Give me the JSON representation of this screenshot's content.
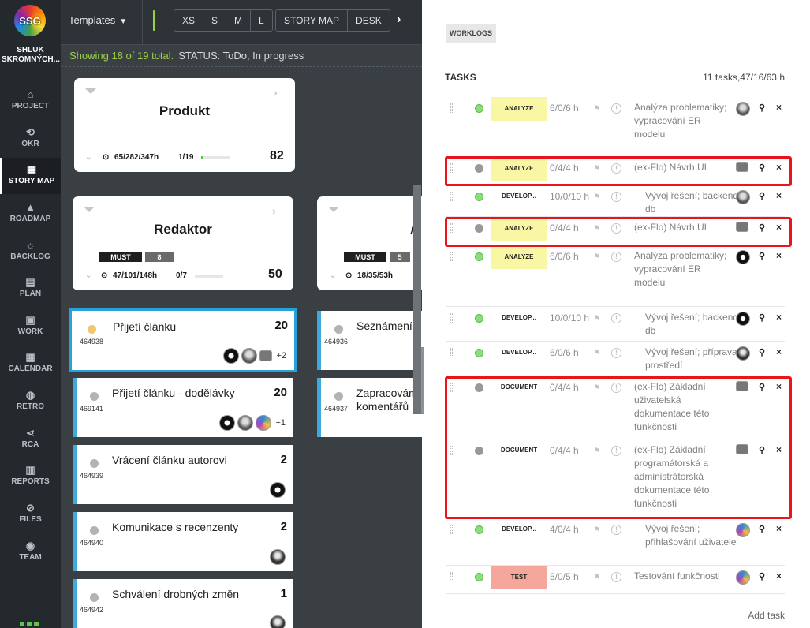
{
  "nav": {
    "logo_text": "SSG",
    "org_name": "SHLUK\nSKROMNÝCH...",
    "items": [
      {
        "label": "PROJECT",
        "icon": "home-icon",
        "glyph": "⌂"
      },
      {
        "label": "OKR",
        "icon": "okr-icon",
        "glyph": "⟲"
      },
      {
        "label": "STORY MAP",
        "icon": "grid-icon",
        "glyph": "▦",
        "active": true
      },
      {
        "label": "ROADMAP",
        "icon": "road-icon",
        "glyph": "▲"
      },
      {
        "label": "BACKLOG",
        "icon": "bulb-icon",
        "glyph": "☼"
      },
      {
        "label": "PLAN",
        "icon": "plan-icon",
        "glyph": "▤"
      },
      {
        "label": "WORK",
        "icon": "briefcase-icon",
        "glyph": "▣"
      },
      {
        "label": "CALENDAR",
        "icon": "calendar-icon",
        "glyph": "▦"
      },
      {
        "label": "RETRO",
        "icon": "chat-icon",
        "glyph": "◍"
      },
      {
        "label": "RCA",
        "icon": "share-icon",
        "glyph": "⋖"
      },
      {
        "label": "REPORTS",
        "icon": "chart-icon",
        "glyph": "▥"
      },
      {
        "label": "FILES",
        "icon": "paperclip-icon",
        "glyph": "⊘"
      },
      {
        "label": "TEAM",
        "icon": "team-icon",
        "glyph": "◉"
      }
    ]
  },
  "topbar": {
    "templates_label": "Templates",
    "sizes": [
      "XS",
      "S",
      "M",
      "L"
    ],
    "views": [
      "STORY MAP",
      "DESK"
    ]
  },
  "filter": {
    "showing": "Showing 18 of 19 total.",
    "status": "STATUS: ToDo, In progress"
  },
  "epics": [
    {
      "title": "Produkt",
      "stats": "65/282/347h",
      "progress": "1/19",
      "progress_fraction": 0.05,
      "count": "82"
    },
    {
      "title": "Redaktor",
      "stats": "47/101/148h",
      "progress": "0/7",
      "progress_fraction": 0,
      "count": "50",
      "tag": "MUST",
      "tag_num": "8"
    },
    {
      "title": "A",
      "stats": "18/35/53h",
      "tag": "MUST",
      "tag_num": "5"
    }
  ],
  "stories": [
    {
      "title": "Přijetí článku",
      "id": "464938",
      "points": "20",
      "more": "+2"
    },
    {
      "title": "Přijetí článku - dodělávky",
      "id": "469141",
      "points": "20",
      "more": "+1"
    },
    {
      "title": "Vrácení článku autorovi",
      "id": "464939",
      "points": "2"
    },
    {
      "title": "Komunikace s recenzenty",
      "id": "464940",
      "points": "2"
    },
    {
      "title": "Schválení drobných změn",
      "id": "464942",
      "points": "1"
    },
    {
      "title": "Seznámení",
      "id": "464936"
    },
    {
      "title": "Zapracován\nkomentářů",
      "id": "464937"
    }
  ],
  "panel": {
    "worklogs_label": "WORKLOGS",
    "tasks_label": "TASKS",
    "tasks_summary": "11  tasks,47/16/63 h",
    "add_task": "Add task",
    "tasks": [
      {
        "type": "ANALYZE",
        "hours": "6/0/6 h",
        "desc": "Analýza problematiky; vypracování ER modelu",
        "status": "green",
        "avatar": "photo"
      },
      {
        "type": "ANALYZE",
        "hours": "0/4/4 h",
        "desc": "(ex-Flo) Návrh UI",
        "status": "gray",
        "avatar": "robot"
      },
      {
        "type": "DEVELOP...",
        "hours": "10/0/10 h",
        "desc": "Vývoj řešení; backend db",
        "status": "green",
        "avatar": "photo"
      },
      {
        "type": "ANALYZE",
        "hours": "0/4/4 h",
        "desc": "(ex-Flo) Návrh UI",
        "status": "gray",
        "avatar": "robot"
      },
      {
        "type": "ANALYZE",
        "hours": "6/0/6 h",
        "desc": "Analýza problematiky; vypracování ER modelu",
        "status": "green",
        "avatar": "spiky"
      },
      {
        "type": "DEVELOP...",
        "hours": "10/0/10 h",
        "desc": "Vývoj řešení; backend db",
        "status": "green",
        "avatar": "spiky"
      },
      {
        "type": "DEVELOP...",
        "hours": "6/0/6 h",
        "desc": "Vývoj řešení; příprava prostředí",
        "status": "green",
        "avatar": "dark"
      },
      {
        "type": "DOCUMENT",
        "hours": "0/4/4 h",
        "desc": "(ex-Flo) Základní uživatelská dokumentace této funkčnosti",
        "status": "gray",
        "avatar": "robot"
      },
      {
        "type": "DOCUMENT",
        "hours": "0/4/4 h",
        "desc": "(ex-Flo) Základní programátorská a administrátorská dokumentace této funkčnosti",
        "status": "gray",
        "avatar": "robot"
      },
      {
        "type": "DEVELOP...",
        "hours": "4/0/4 h",
        "desc": "Vývoj řešení; přihlašování uživatele",
        "status": "green",
        "avatar": "colorful"
      },
      {
        "type": "TEST",
        "hours": "5/0/5 h",
        "desc": "Testování funkčnosti",
        "status": "green",
        "avatar": "colorful"
      }
    ]
  },
  "colors": {
    "accent": "#3fa9dc",
    "green": "#9bd14a",
    "highlight": "#e8161b",
    "analyze": "#f9f7a4",
    "test": "#f6a79b"
  }
}
